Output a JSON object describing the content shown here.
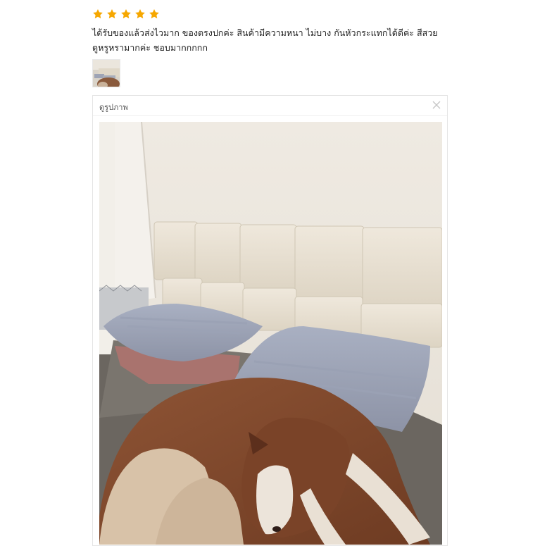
{
  "review": {
    "rating": 5,
    "star_color": "#f6a700",
    "text": "ได้รับของแล้วส่งไวมาก ของตรงปกค่ะ สินค้ามีความหนา ไม่บาง กันหัวกระแทกได้ดีค่ะ สีสวยดูหรูหรามากค่ะ ชอบมากกกกก"
  },
  "thumbnail": {
    "icon": "bed-photo-thumbnail"
  },
  "viewer": {
    "title": "ดูรูปภาพ",
    "close_icon": "close-icon",
    "photo": "bed-with-headboard-and-dog"
  }
}
